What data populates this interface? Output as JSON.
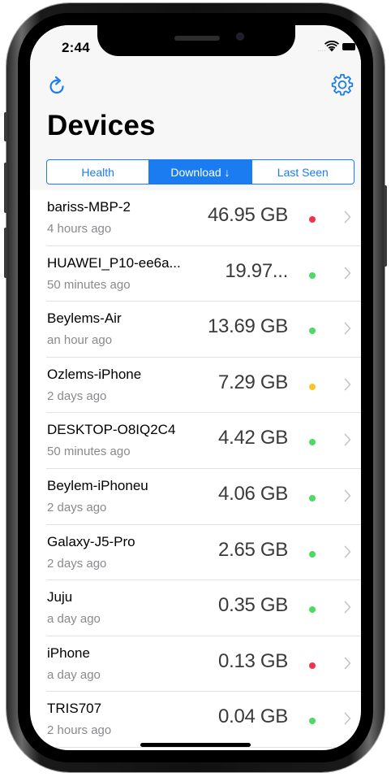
{
  "status_bar": {
    "time": "2:44"
  },
  "toolbar": {
    "reload_icon": "reload-icon",
    "settings_icon": "gear-icon"
  },
  "page_title": "Devices",
  "segments": [
    {
      "label": "Health",
      "active": false
    },
    {
      "label": "Download ↓",
      "active": true
    },
    {
      "label": "Last Seen",
      "active": false
    }
  ],
  "colors": {
    "accent": "#1a7cf0",
    "status_red": "#f0334f",
    "status_green": "#4cd964",
    "status_yellow": "#f8c524"
  },
  "devices": [
    {
      "name": "bariss-MBP-2",
      "last_seen": "4 hours ago",
      "download": "46.95 GB",
      "status": "red"
    },
    {
      "name": "HUAWEI_P10-ee6a...",
      "last_seen": "50 minutes ago",
      "download": "19.97...",
      "status": "green"
    },
    {
      "name": "Beylems-Air",
      "last_seen": "an hour ago",
      "download": "13.69 GB",
      "status": "green"
    },
    {
      "name": "Ozlems-iPhone",
      "last_seen": "2 days ago",
      "download": "7.29 GB",
      "status": "yellow"
    },
    {
      "name": "DESKTOP-O8IQ2C4",
      "last_seen": "50 minutes ago",
      "download": "4.42 GB",
      "status": "green"
    },
    {
      "name": "Beylem-iPhoneu",
      "last_seen": "2 days ago",
      "download": "4.06 GB",
      "status": "green"
    },
    {
      "name": "Galaxy-J5-Pro",
      "last_seen": "2 days ago",
      "download": "2.65 GB",
      "status": "green"
    },
    {
      "name": "Juju",
      "last_seen": "a day ago",
      "download": "0.35 GB",
      "status": "green"
    },
    {
      "name": "iPhone",
      "last_seen": "a day ago",
      "download": "0.13 GB",
      "status": "red"
    },
    {
      "name": "TRIS707",
      "last_seen": "2 hours ago",
      "download": "0.04 GB",
      "status": "green"
    }
  ]
}
